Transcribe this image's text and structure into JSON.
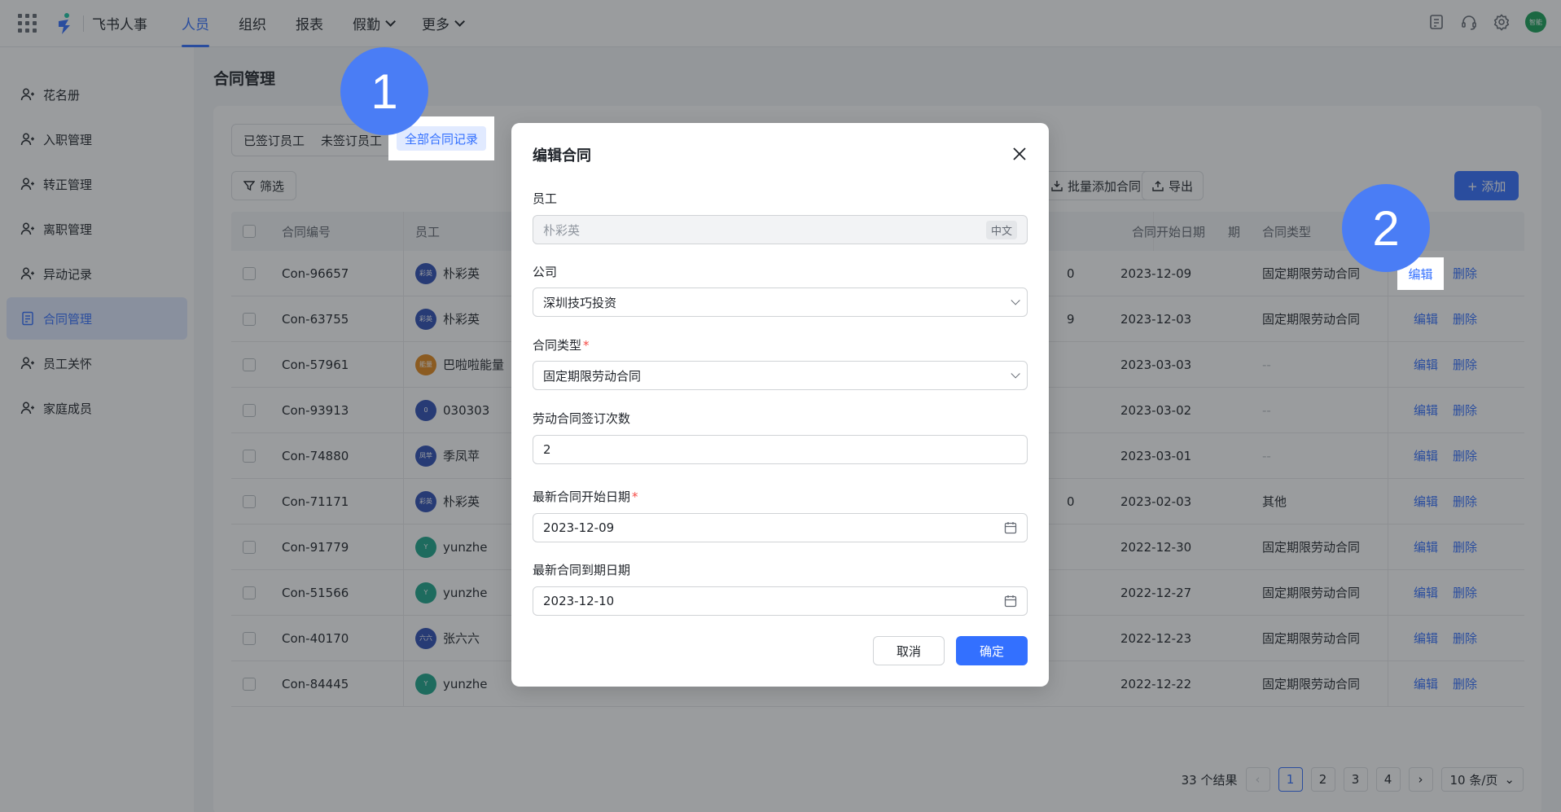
{
  "brand": "飞书人事",
  "nav": [
    {
      "label": "人员",
      "active": true,
      "dropdown": false
    },
    {
      "label": "组织",
      "active": false,
      "dropdown": false
    },
    {
      "label": "报表",
      "active": false,
      "dropdown": false
    },
    {
      "label": "假勤",
      "active": false,
      "dropdown": true
    },
    {
      "label": "更多",
      "active": false,
      "dropdown": true
    }
  ],
  "top_right": {
    "avatar_text": "智能"
  },
  "sidebar": [
    {
      "label": "花名册",
      "icon": "users-icon",
      "active": false
    },
    {
      "label": "入职管理",
      "icon": "user-add-icon",
      "active": false
    },
    {
      "label": "转正管理",
      "icon": "user-check-icon",
      "active": false
    },
    {
      "label": "离职管理",
      "icon": "user-remove-icon",
      "active": false
    },
    {
      "label": "异动记录",
      "icon": "user-transfer-icon",
      "active": false
    },
    {
      "label": "合同管理",
      "icon": "document-icon",
      "active": true
    },
    {
      "label": "员工关怀",
      "icon": "user-care-icon",
      "active": false
    },
    {
      "label": "家庭成员",
      "icon": "family-icon",
      "active": false
    }
  ],
  "page_title": "合同管理",
  "segments": [
    "已签订员工",
    "未签订员工",
    "全部合同记录"
  ],
  "filter_label": "筛选",
  "toolbar": {
    "bulk_add": "批量添加合同",
    "export": "导出",
    "add": "+ 添加"
  },
  "table": {
    "headers": {
      "no": "合同编号",
      "employee": "员工",
      "start": "合同开始日期",
      "type": "合同类型",
      "partial": "期"
    },
    "rows": [
      {
        "no": "Con-96657",
        "emp": "朴彩英",
        "av": "彩英",
        "avc": "#2f4fb5",
        "mid": "0",
        "start": "2023-12-09",
        "type": "固定期限劳动合同"
      },
      {
        "no": "Con-63755",
        "emp": "朴彩英",
        "av": "彩英",
        "avc": "#2f4fb5",
        "mid": "9",
        "start": "2023-12-03",
        "type": "固定期限劳动合同"
      },
      {
        "no": "Con-57961",
        "emp": "巴啦啦能量",
        "av": "能量",
        "avc": "#e3891d",
        "mid": "",
        "start": "2023-03-03",
        "type": "--"
      },
      {
        "no": "Con-93913",
        "emp": "030303",
        "av": "0",
        "avc": "#2f4fb5",
        "mid": "",
        "start": "2023-03-02",
        "type": "--"
      },
      {
        "no": "Con-74880",
        "emp": "季凤苹",
        "av": "凤苹",
        "avc": "#2f4fb5",
        "mid": "",
        "start": "2023-03-01",
        "type": "--"
      },
      {
        "no": "Con-71171",
        "emp": "朴彩英",
        "av": "彩英",
        "avc": "#2f4fb5",
        "mid": "0",
        "start": "2023-02-03",
        "type": "其他"
      },
      {
        "no": "Con-91779",
        "emp": "yunzhe",
        "av": "Y",
        "avc": "#1ea68a",
        "mid": "",
        "start": "2022-12-30",
        "type": "固定期限劳动合同"
      },
      {
        "no": "Con-51566",
        "emp": "yunzhe",
        "av": "Y",
        "avc": "#1ea68a",
        "mid": "",
        "start": "2022-12-27",
        "type": "固定期限劳动合同"
      },
      {
        "no": "Con-40170",
        "emp": "张六六",
        "av": "六六",
        "avc": "#2f4fb5",
        "mid": "",
        "start": "2022-12-23",
        "type": "固定期限劳动合同"
      },
      {
        "no": "Con-84445",
        "emp": "yunzhe",
        "av": "Y",
        "avc": "#1ea68a",
        "mid": "",
        "start": "2022-12-22",
        "type": "固定期限劳动合同"
      }
    ],
    "edit": "编辑",
    "delete": "删除"
  },
  "pagination": {
    "total": "33 个结果",
    "pages": [
      "1",
      "2",
      "3",
      "4"
    ],
    "current": "1",
    "page_size": "10 条/页"
  },
  "modal": {
    "title": "编辑合同",
    "employee_label": "员工",
    "employee_value": "朴彩英",
    "employee_lang": "中文",
    "company_label": "公司",
    "company_value": "深圳技巧投资",
    "type_label": "合同类型",
    "type_value": "固定期限劳动合同",
    "count_label": "劳动合同签订次数",
    "count_value": "2",
    "start_label": "最新合同开始日期",
    "start_value": "2023-12-09",
    "end_label": "最新合同到期日期",
    "end_value": "2023-12-10",
    "cancel": "取消",
    "confirm": "确定"
  },
  "steps": [
    "1",
    "2"
  ],
  "colors": {
    "accent": "#3370ff",
    "required": "#f54a45",
    "step": "#4a7df5"
  }
}
